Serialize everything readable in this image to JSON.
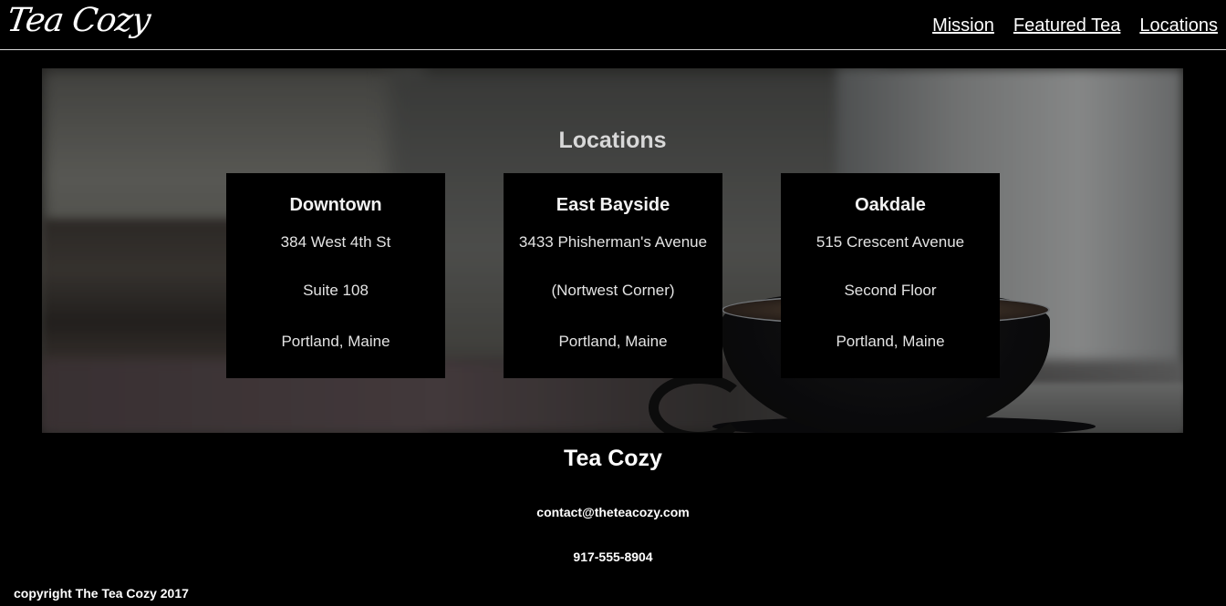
{
  "header": {
    "logo": "Tea Cozy",
    "nav": [
      {
        "label": "Mission"
      },
      {
        "label": "Featured Tea"
      },
      {
        "label": "Locations"
      }
    ]
  },
  "locations": {
    "title": "Locations",
    "cards": [
      {
        "name": "Downtown",
        "lines": [
          "384 West 4th St",
          "Suite 108",
          "Portland, Maine"
        ]
      },
      {
        "name": "East Bayside",
        "lines": [
          "3433 Phisherman's Avenue",
          "(Nortwest Corner)",
          "Portland, Maine"
        ]
      },
      {
        "name": "Oakdale",
        "lines": [
          "515 Crescent Avenue",
          "Second Floor",
          "Portland, Maine"
        ]
      }
    ]
  },
  "footer": {
    "title": "Tea Cozy",
    "email": "contact@theteacozy.com",
    "phone": "917-555-8904",
    "copyright": "copyright The Tea Cozy 2017"
  },
  "colors": {
    "background": "#000000",
    "text": "#ffffff"
  }
}
